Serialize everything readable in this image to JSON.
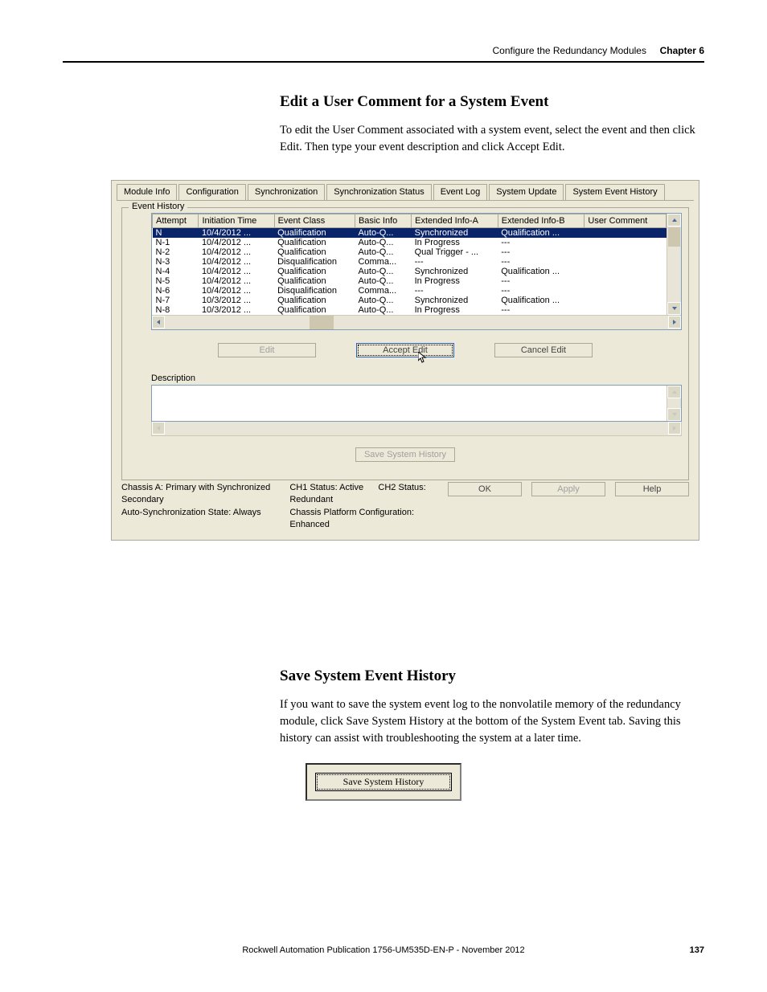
{
  "header": {
    "title": "Configure the Redundancy Modules",
    "chapter_label": "Chapter 6"
  },
  "section1": {
    "heading": "Edit a User Comment for a System Event",
    "body": "To edit the User Comment associated with a system event, select the event and then click Edit. Then type your event description and click Accept Edit."
  },
  "section2": {
    "heading": "Save System Event History",
    "body": "If you want to save the system event log to the nonvolatile memory of the redundancy module, click Save System History at the bottom of the System Event tab. Saving this history can assist with troubleshooting the system at a later time."
  },
  "tabs": [
    "Module Info",
    "Configuration",
    "Synchronization",
    "Synchronization Status",
    "Event Log",
    "System Update",
    "System Event History"
  ],
  "event_history": {
    "legend": "Event History",
    "columns": [
      "Attempt",
      "Initiation Time",
      "Event Class",
      "Basic Info",
      "Extended Info-A",
      "Extended Info-B",
      "User Comment"
    ],
    "rows": [
      {
        "attempt": "N",
        "time": "10/4/2012 ...",
        "eclass": "Qualification",
        "basic": "Auto-Q...",
        "extA": "Synchronized",
        "extB": "Qualification ...",
        "comment": ""
      },
      {
        "attempt": "N-1",
        "time": "10/4/2012 ...",
        "eclass": "Qualification",
        "basic": "Auto-Q...",
        "extA": "In Progress",
        "extB": "---",
        "comment": ""
      },
      {
        "attempt": "N-2",
        "time": "10/4/2012 ...",
        "eclass": "Qualification",
        "basic": "Auto-Q...",
        "extA": "Qual Trigger - ...",
        "extB": "---",
        "comment": ""
      },
      {
        "attempt": "N-3",
        "time": "10/4/2012 ...",
        "eclass": "Disqualification",
        "basic": "Comma...",
        "extA": "---",
        "extB": "---",
        "comment": ""
      },
      {
        "attempt": "N-4",
        "time": "10/4/2012 ...",
        "eclass": "Qualification",
        "basic": "Auto-Q...",
        "extA": "Synchronized",
        "extB": "Qualification ...",
        "comment": ""
      },
      {
        "attempt": "N-5",
        "time": "10/4/2012 ...",
        "eclass": "Qualification",
        "basic": "Auto-Q...",
        "extA": "In Progress",
        "extB": "---",
        "comment": ""
      },
      {
        "attempt": "N-6",
        "time": "10/4/2012 ...",
        "eclass": "Disqualification",
        "basic": "Comma...",
        "extA": "---",
        "extB": "---",
        "comment": ""
      },
      {
        "attempt": "N-7",
        "time": "10/3/2012 ...",
        "eclass": "Qualification",
        "basic": "Auto-Q...",
        "extA": "Synchronized",
        "extB": "Qualification ...",
        "comment": ""
      },
      {
        "attempt": "N-8",
        "time": "10/3/2012 ...",
        "eclass": "Qualification",
        "basic": "Auto-Q...",
        "extA": "In Progress",
        "extB": "---",
        "comment": ""
      }
    ]
  },
  "buttons": {
    "edit": "Edit",
    "accept_edit": "Accept Edit",
    "cancel_edit": "Cancel Edit",
    "save_history": "Save System History",
    "ok": "OK",
    "apply": "Apply",
    "help": "Help"
  },
  "description_label": "Description",
  "status": {
    "chassis_a": "Chassis A: Primary with Synchronized Secondary",
    "autosync": "Auto-Synchronization State: Always",
    "ch1": "CH1 Status: Active",
    "ch2": "CH2 Status: Redundant",
    "platform": "Chassis Platform Configuration: Enhanced"
  },
  "standalone_save_btn": "Save System History",
  "footer": {
    "text": "Rockwell Automation Publication 1756-UM535D-EN-P - November 2012",
    "page": "137"
  }
}
